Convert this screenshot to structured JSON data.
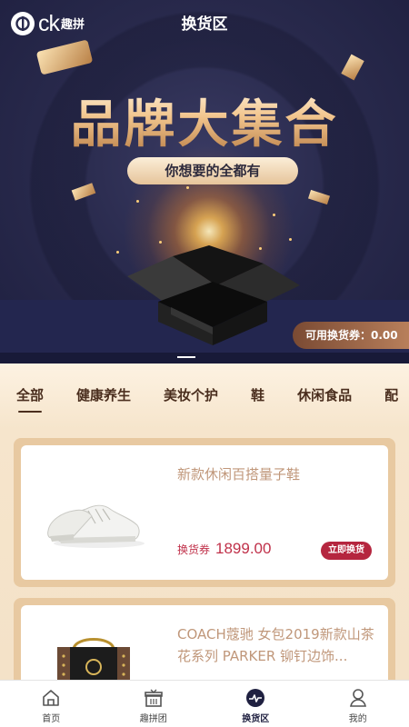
{
  "header": {
    "logo_text": "ck",
    "logo_sub": "趣拼",
    "title": "换货区"
  },
  "banner": {
    "headline": "品牌大集合",
    "tagline": "你想要的全都有",
    "voucher_label": "可用换货券：",
    "voucher_value": "0.00"
  },
  "tabs": [
    {
      "label": "全部",
      "active": true
    },
    {
      "label": "健康养生",
      "active": false
    },
    {
      "label": "美妆个护",
      "active": false
    },
    {
      "label": "鞋",
      "active": false
    },
    {
      "label": "休闲食品",
      "active": false
    },
    {
      "label": "配",
      "active": false
    }
  ],
  "products": [
    {
      "title": "新款休闲百搭量子鞋",
      "price_label": "换货券",
      "price": "1899.00",
      "button_label": "立即换货",
      "image_icon": "sneaker-icon"
    },
    {
      "title": "COACH蔻驰 女包2019新款山茶花系列 PARKER 铆钉边饰...",
      "image_icon": "handbag-icon"
    }
  ],
  "nav": [
    {
      "label": "首页",
      "icon": "home-icon",
      "active": false
    },
    {
      "label": "趣拼团",
      "icon": "gift-icon",
      "active": false
    },
    {
      "label": "换货区",
      "icon": "exchange-icon",
      "active": true
    },
    {
      "label": "我的",
      "icon": "user-icon",
      "active": false
    }
  ],
  "colors": {
    "banner_bg": "#2a2b4e",
    "accent_gold": "#e8c9a1",
    "price_red": "#c0314a",
    "button_red": "#b5263f",
    "tab_text": "#4a2e1e"
  }
}
